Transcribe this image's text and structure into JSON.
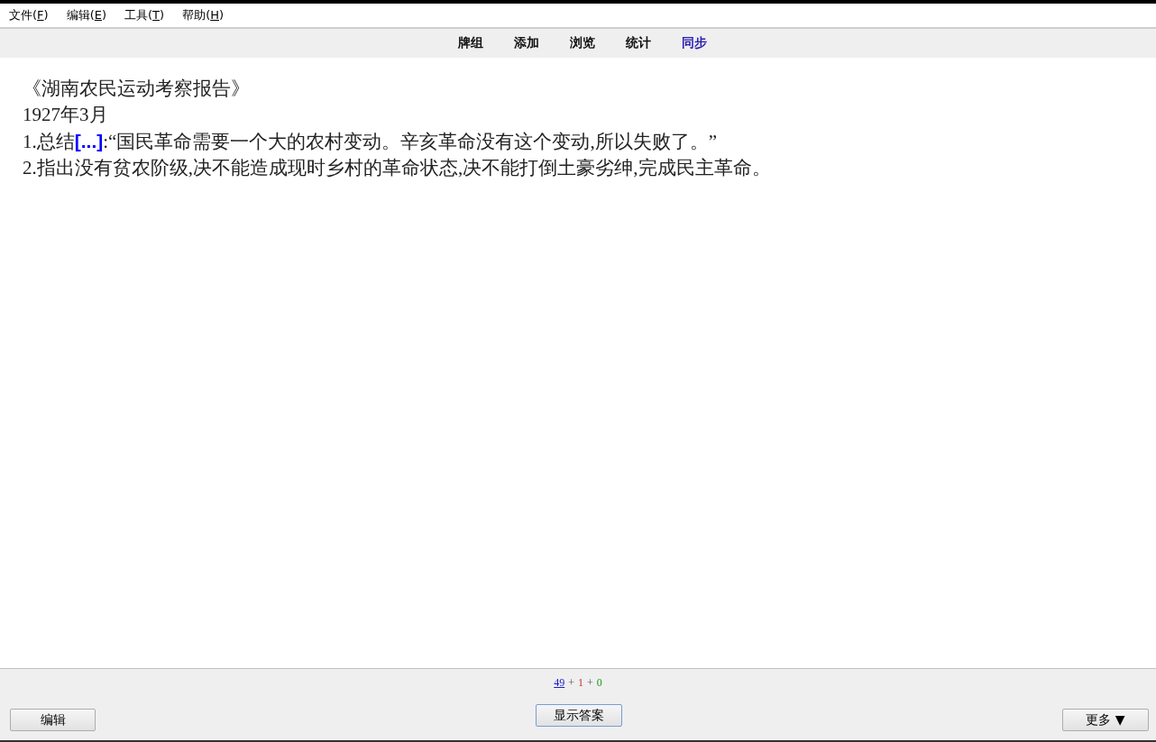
{
  "menu": [
    {
      "label": "文件(",
      "key": "F",
      "end": ")"
    },
    {
      "label": "编辑(",
      "key": "E",
      "end": ")"
    },
    {
      "label": "工具(",
      "key": "T",
      "end": ")"
    },
    {
      "label": "帮助(",
      "key": "H",
      "end": ")"
    }
  ],
  "toolbar": [
    {
      "label": "牌组",
      "selected": false
    },
    {
      "label": "添加",
      "selected": false
    },
    {
      "label": "浏览",
      "selected": false
    },
    {
      "label": "统计",
      "selected": false
    },
    {
      "label": "同步",
      "selected": true
    }
  ],
  "card": {
    "lines": [
      {
        "parts": [
          {
            "text": "《湖南农民运动考察报告》",
            "kind": "plain"
          }
        ]
      },
      {
        "parts": [
          {
            "text": "1927年3月",
            "kind": "plain"
          }
        ]
      },
      {
        "parts": [
          {
            "text": "1.总结",
            "kind": "plain"
          },
          {
            "text": "[...]",
            "kind": "cloze"
          },
          {
            "text": ":“国民革命需要一个大的农村变动。辛亥革命没有这个变动,所以失败了。”",
            "kind": "plain"
          }
        ]
      },
      {
        "parts": [
          {
            "text": "2.指出没有贫农阶级,决不能造成现时乡村的革命状态,决不能打倒土豪劣绅,完成民主革命。",
            "kind": "plain"
          }
        ]
      }
    ]
  },
  "counts": [
    {
      "text": "49",
      "kind": "new"
    },
    {
      "text": "+",
      "kind": "separator"
    },
    {
      "text": "1",
      "kind": "learning"
    },
    {
      "text": "+",
      "kind": "separator"
    },
    {
      "text": "0",
      "kind": "review"
    }
  ],
  "buttons": {
    "edit": "编辑",
    "show_answer": "显示答案",
    "more": "更多 ▼"
  }
}
